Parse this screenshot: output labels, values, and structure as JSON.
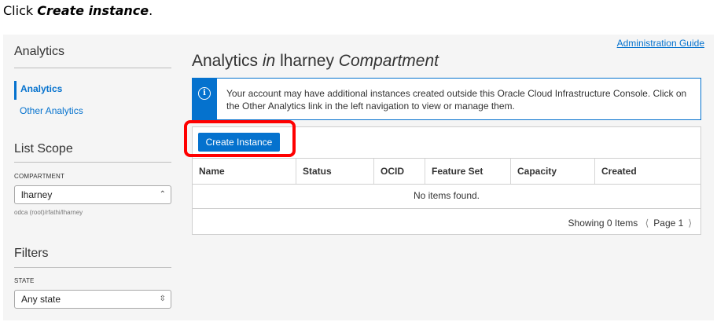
{
  "instruction": {
    "prefix": "Click ",
    "target": "Create instance",
    "suffix": "."
  },
  "sidebar": {
    "title": "Analytics",
    "nav": [
      {
        "label": "Analytics",
        "active": true
      },
      {
        "label": "Other Analytics",
        "active": false
      }
    ],
    "list_scope": {
      "heading": "List Scope",
      "compartment_label": "COMPARTMENT",
      "compartment_value": "lharney",
      "compartment_path": "odca (root)/rfathi/lharney"
    },
    "filters": {
      "heading": "Filters",
      "state_label": "STATE",
      "state_value": "Any state"
    }
  },
  "header": {
    "admin_link": "Administration Guide",
    "title_part1": "Analytics ",
    "title_in": "in",
    "title_part2": " lharney ",
    "title_compartment": "Compartment"
  },
  "info": {
    "icon": "info-icon",
    "text": "Your account may have additional instances created outside this Oracle Cloud Infrastructure Console. Click on the Other Analytics link in the left navigation to view or manage them."
  },
  "toolbar": {
    "create_label": "Create Instance"
  },
  "table": {
    "columns": [
      "Name",
      "Status",
      "OCID",
      "Feature Set",
      "Capacity",
      "Created"
    ],
    "empty_text": "No items found."
  },
  "pager": {
    "showing": "Showing 0 Items",
    "page": "Page 1"
  },
  "colors": {
    "accent": "#0572ce",
    "highlight": "#ff0000"
  }
}
